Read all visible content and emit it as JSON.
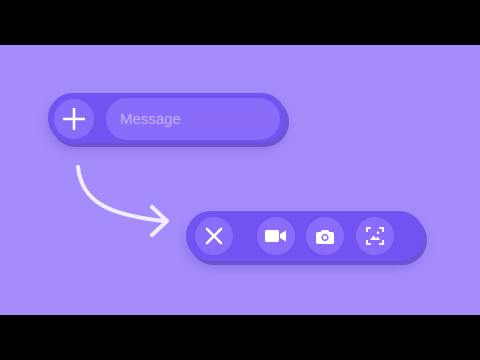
{
  "composer_collapsed": {
    "add_icon": "plus-icon",
    "message_placeholder": "Message"
  },
  "composer_expanded": {
    "close_icon": "close-icon",
    "actions": [
      {
        "icon": "video-camera-icon"
      },
      {
        "icon": "camera-icon"
      },
      {
        "icon": "gallery-icon"
      }
    ]
  },
  "colors": {
    "background": "#a68cfb",
    "bar": "#7352f2",
    "button": "#8a6bfa",
    "placeholder": "#c4b4fb",
    "icon": "#ffffff",
    "arrow": "#f1ecff"
  }
}
